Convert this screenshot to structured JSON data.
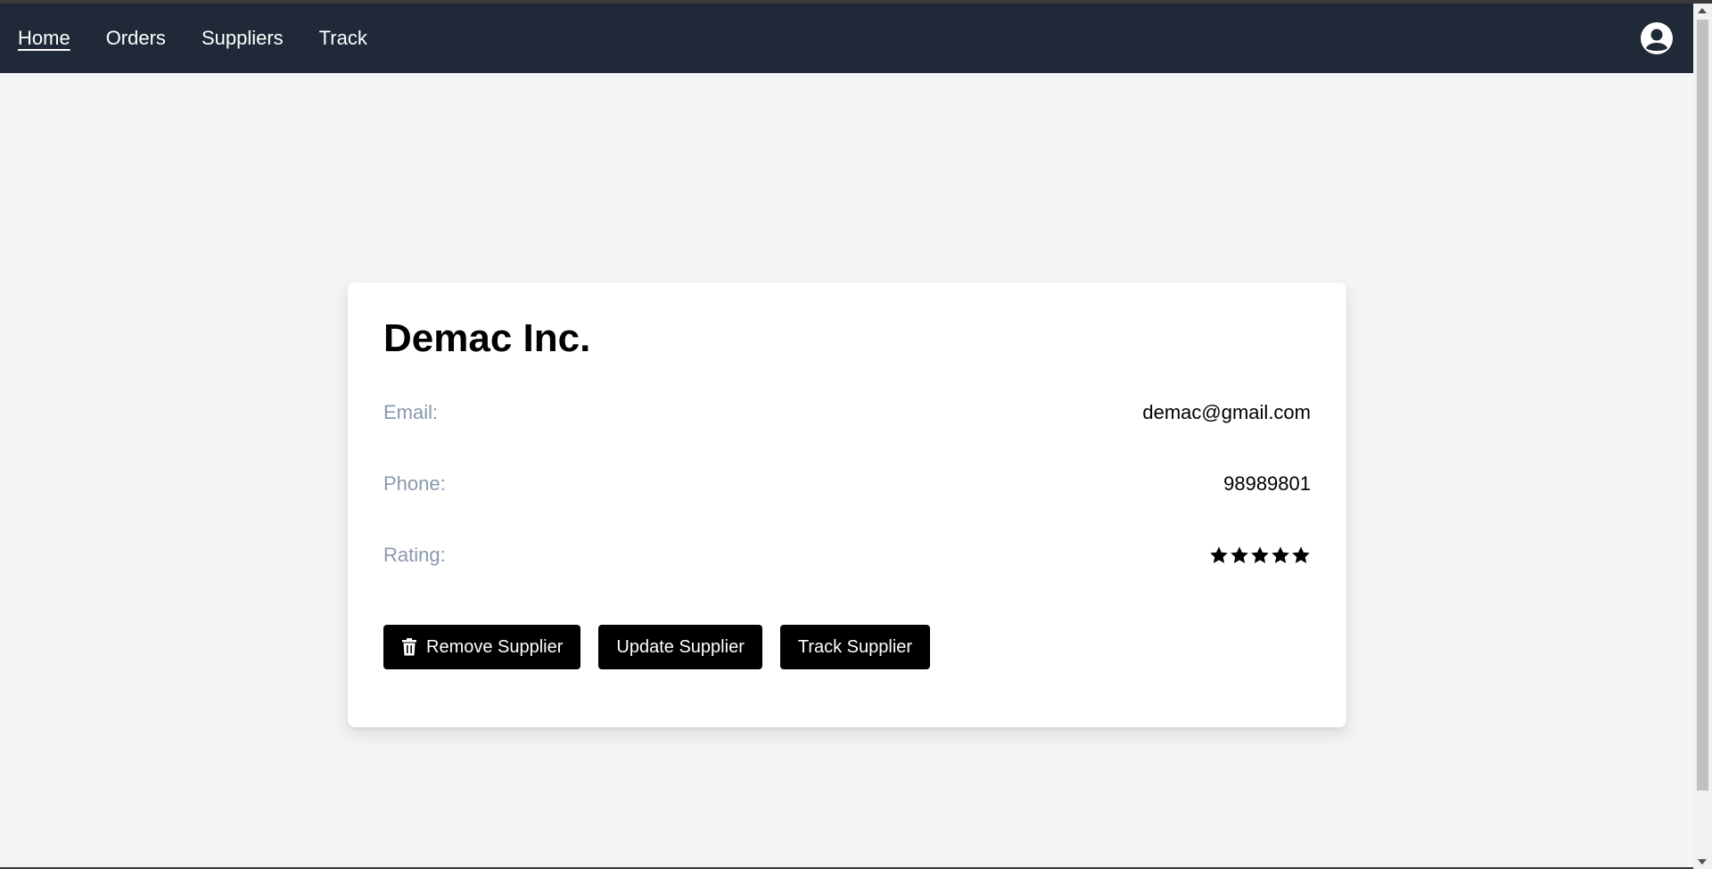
{
  "nav": {
    "links": [
      {
        "label": "Home"
      },
      {
        "label": "Orders"
      },
      {
        "label": "Suppliers"
      },
      {
        "label": "Track"
      }
    ],
    "account_icon": "user-circle-icon"
  },
  "supplier": {
    "name": "Demac Inc.",
    "email_label": "Email:",
    "email": "demac@gmail.com",
    "phone_label": "Phone:",
    "phone": "98989801",
    "rating_label": "Rating:",
    "rating": 5,
    "rating_max": 5
  },
  "actions": {
    "remove_label": "Remove Supplier",
    "remove_icon": "trash-icon",
    "update_label": "Update Supplier",
    "track_label": "Track Supplier"
  },
  "colors": {
    "navbar": "#1f2937",
    "background": "#f3f4f6",
    "label": "#8a99ab",
    "button": "#000000"
  }
}
